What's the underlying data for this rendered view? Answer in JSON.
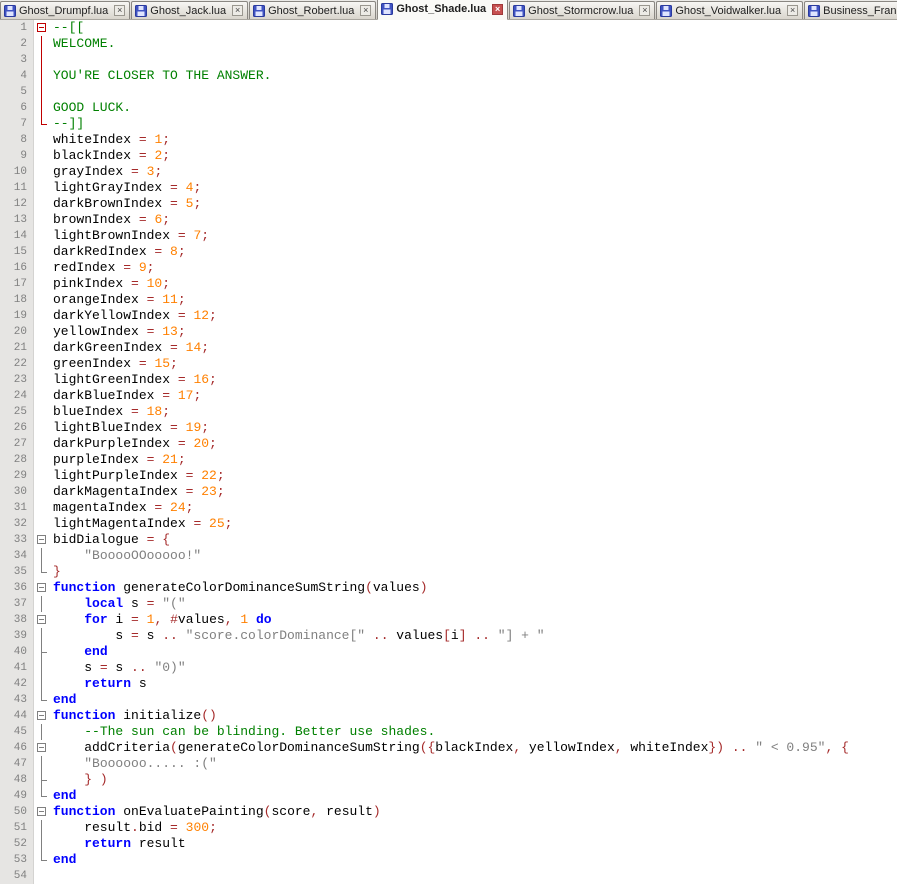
{
  "tab_bar": {
    "tab_icon": "floppy-disk-icon",
    "close_icon_name": "close-icon",
    "close_icon": "×",
    "tabs": [
      {
        "label": "Ghost_Drumpf.lua",
        "active": false
      },
      {
        "label": "Ghost_Jack.lua",
        "active": false
      },
      {
        "label": "Ghost_Robert.lua",
        "active": false
      },
      {
        "label": "Ghost_Shade.lua",
        "active": true
      },
      {
        "label": "Ghost_Stormcrow.lua",
        "active": false
      },
      {
        "label": "Ghost_Voidwalker.lua",
        "active": false
      },
      {
        "label": "Business_Frank.lua",
        "active": false
      }
    ]
  },
  "colors": {
    "comment": "#008000",
    "keyword": "#0000FF",
    "number": "#FF8000",
    "string": "#808080",
    "operator": "#A52A2A",
    "plain": "#000000",
    "line_number": "#808080",
    "margin_bg": "#E6E5E3",
    "fold": "#808080",
    "fold_active": "#C00000",
    "tab_close_active_bg": "#C75050"
  },
  "editor": {
    "lines": [
      {
        "n": 1,
        "fold": "open",
        "hot": true,
        "t": [
          [
            "c",
            "--[["
          ]
        ]
      },
      {
        "n": 2,
        "fold": "line",
        "hot": true,
        "t": [
          [
            "c",
            "WELCOME."
          ]
        ]
      },
      {
        "n": 3,
        "fold": "line",
        "hot": true,
        "t": []
      },
      {
        "n": 4,
        "fold": "line",
        "hot": true,
        "t": [
          [
            "c",
            "YOU'RE CLOSER TO THE ANSWER."
          ]
        ]
      },
      {
        "n": 5,
        "fold": "line",
        "hot": true,
        "t": []
      },
      {
        "n": 6,
        "fold": "line",
        "hot": true,
        "t": [
          [
            "c",
            "GOOD LUCK."
          ]
        ]
      },
      {
        "n": 7,
        "fold": "end",
        "hot": true,
        "t": [
          [
            "c",
            "--]]"
          ]
        ]
      },
      {
        "n": 8,
        "t": [
          [
            "p",
            "whiteIndex "
          ],
          [
            "o",
            "= "
          ],
          [
            "num",
            "1"
          ],
          [
            "o",
            ";"
          ]
        ]
      },
      {
        "n": 9,
        "t": [
          [
            "p",
            "blackIndex "
          ],
          [
            "o",
            "= "
          ],
          [
            "num",
            "2"
          ],
          [
            "o",
            ";"
          ]
        ]
      },
      {
        "n": 10,
        "t": [
          [
            "p",
            "grayIndex "
          ],
          [
            "o",
            "= "
          ],
          [
            "num",
            "3"
          ],
          [
            "o",
            ";"
          ]
        ]
      },
      {
        "n": 11,
        "t": [
          [
            "p",
            "lightGrayIndex "
          ],
          [
            "o",
            "= "
          ],
          [
            "num",
            "4"
          ],
          [
            "o",
            ";"
          ]
        ]
      },
      {
        "n": 12,
        "t": [
          [
            "p",
            "darkBrownIndex "
          ],
          [
            "o",
            "= "
          ],
          [
            "num",
            "5"
          ],
          [
            "o",
            ";"
          ]
        ]
      },
      {
        "n": 13,
        "t": [
          [
            "p",
            "brownIndex "
          ],
          [
            "o",
            "= "
          ],
          [
            "num",
            "6"
          ],
          [
            "o",
            ";"
          ]
        ]
      },
      {
        "n": 14,
        "t": [
          [
            "p",
            "lightBrownIndex "
          ],
          [
            "o",
            "= "
          ],
          [
            "num",
            "7"
          ],
          [
            "o",
            ";"
          ]
        ]
      },
      {
        "n": 15,
        "t": [
          [
            "p",
            "darkRedIndex "
          ],
          [
            "o",
            "= "
          ],
          [
            "num",
            "8"
          ],
          [
            "o",
            ";"
          ]
        ]
      },
      {
        "n": 16,
        "t": [
          [
            "p",
            "redIndex "
          ],
          [
            "o",
            "= "
          ],
          [
            "num",
            "9"
          ],
          [
            "o",
            ";"
          ]
        ]
      },
      {
        "n": 17,
        "t": [
          [
            "p",
            "pinkIndex "
          ],
          [
            "o",
            "= "
          ],
          [
            "num",
            "10"
          ],
          [
            "o",
            ";"
          ]
        ]
      },
      {
        "n": 18,
        "t": [
          [
            "p",
            "orangeIndex "
          ],
          [
            "o",
            "= "
          ],
          [
            "num",
            "11"
          ],
          [
            "o",
            ";"
          ]
        ]
      },
      {
        "n": 19,
        "t": [
          [
            "p",
            "darkYellowIndex "
          ],
          [
            "o",
            "= "
          ],
          [
            "num",
            "12"
          ],
          [
            "o",
            ";"
          ]
        ]
      },
      {
        "n": 20,
        "t": [
          [
            "p",
            "yellowIndex "
          ],
          [
            "o",
            "= "
          ],
          [
            "num",
            "13"
          ],
          [
            "o",
            ";"
          ]
        ]
      },
      {
        "n": 21,
        "t": [
          [
            "p",
            "darkGreenIndex "
          ],
          [
            "o",
            "= "
          ],
          [
            "num",
            "14"
          ],
          [
            "o",
            ";"
          ]
        ]
      },
      {
        "n": 22,
        "t": [
          [
            "p",
            "greenIndex "
          ],
          [
            "o",
            "= "
          ],
          [
            "num",
            "15"
          ],
          [
            "o",
            ";"
          ]
        ]
      },
      {
        "n": 23,
        "t": [
          [
            "p",
            "lightGreenIndex "
          ],
          [
            "o",
            "= "
          ],
          [
            "num",
            "16"
          ],
          [
            "o",
            ";"
          ]
        ]
      },
      {
        "n": 24,
        "t": [
          [
            "p",
            "darkBlueIndex "
          ],
          [
            "o",
            "= "
          ],
          [
            "num",
            "17"
          ],
          [
            "o",
            ";"
          ]
        ]
      },
      {
        "n": 25,
        "t": [
          [
            "p",
            "blueIndex "
          ],
          [
            "o",
            "= "
          ],
          [
            "num",
            "18"
          ],
          [
            "o",
            ";"
          ]
        ]
      },
      {
        "n": 26,
        "t": [
          [
            "p",
            "lightBlueIndex "
          ],
          [
            "o",
            "= "
          ],
          [
            "num",
            "19"
          ],
          [
            "o",
            ";"
          ]
        ]
      },
      {
        "n": 27,
        "t": [
          [
            "p",
            "darkPurpleIndex "
          ],
          [
            "o",
            "= "
          ],
          [
            "num",
            "20"
          ],
          [
            "o",
            ";"
          ]
        ]
      },
      {
        "n": 28,
        "t": [
          [
            "p",
            "purpleIndex "
          ],
          [
            "o",
            "= "
          ],
          [
            "num",
            "21"
          ],
          [
            "o",
            ";"
          ]
        ]
      },
      {
        "n": 29,
        "t": [
          [
            "p",
            "lightPurpleIndex "
          ],
          [
            "o",
            "= "
          ],
          [
            "num",
            "22"
          ],
          [
            "o",
            ";"
          ]
        ]
      },
      {
        "n": 30,
        "t": [
          [
            "p",
            "darkMagentaIndex "
          ],
          [
            "o",
            "= "
          ],
          [
            "num",
            "23"
          ],
          [
            "o",
            ";"
          ]
        ]
      },
      {
        "n": 31,
        "t": [
          [
            "p",
            "magentaIndex "
          ],
          [
            "o",
            "= "
          ],
          [
            "num",
            "24"
          ],
          [
            "o",
            ";"
          ]
        ]
      },
      {
        "n": 32,
        "t": [
          [
            "p",
            "lightMagentaIndex "
          ],
          [
            "o",
            "= "
          ],
          [
            "num",
            "25"
          ],
          [
            "o",
            ";"
          ]
        ]
      },
      {
        "n": 33,
        "fold": "open",
        "t": [
          [
            "p",
            "bidDialogue "
          ],
          [
            "o",
            "= {"
          ]
        ]
      },
      {
        "n": 34,
        "fold": "line",
        "t": [
          [
            "p",
            "    "
          ],
          [
            "s",
            "\"BooooOOooooo!\""
          ]
        ]
      },
      {
        "n": 35,
        "fold": "end",
        "t": [
          [
            "o",
            "}"
          ]
        ]
      },
      {
        "n": 36,
        "fold": "open",
        "t": [
          [
            "k",
            "function"
          ],
          [
            "p",
            " generateColorDominanceSumString"
          ],
          [
            "o",
            "("
          ],
          [
            "p",
            "values"
          ],
          [
            "o",
            ")"
          ]
        ]
      },
      {
        "n": 37,
        "fold": "line",
        "t": [
          [
            "p",
            "    "
          ],
          [
            "k",
            "local"
          ],
          [
            "p",
            " s "
          ],
          [
            "o",
            "= "
          ],
          [
            "s",
            "\"(\""
          ]
        ]
      },
      {
        "n": 38,
        "fold": "open",
        "t": [
          [
            "p",
            "    "
          ],
          [
            "k",
            "for"
          ],
          [
            "p",
            " i "
          ],
          [
            "o",
            "= "
          ],
          [
            "num",
            "1"
          ],
          [
            "o",
            ","
          ],
          [
            "p",
            " "
          ],
          [
            "o",
            "#"
          ],
          [
            "p",
            "values"
          ],
          [
            "o",
            ","
          ],
          [
            "p",
            " "
          ],
          [
            "num",
            "1"
          ],
          [
            "p",
            " "
          ],
          [
            "k",
            "do"
          ]
        ]
      },
      {
        "n": 39,
        "fold": "line",
        "t": [
          [
            "p",
            "        s "
          ],
          [
            "o",
            "= "
          ],
          [
            "p",
            "s "
          ],
          [
            "o",
            ".. "
          ],
          [
            "s",
            "\"score.colorDominance[\""
          ],
          [
            "p",
            " "
          ],
          [
            "o",
            ".. "
          ],
          [
            "p",
            "values"
          ],
          [
            "o",
            "["
          ],
          [
            "p",
            "i"
          ],
          [
            "o",
            "]"
          ],
          [
            "p",
            " "
          ],
          [
            "o",
            ".. "
          ],
          [
            "s",
            "\"] + \""
          ]
        ]
      },
      {
        "n": 40,
        "fold": "tee",
        "t": [
          [
            "p",
            "    "
          ],
          [
            "k",
            "end"
          ]
        ]
      },
      {
        "n": 41,
        "fold": "line",
        "t": [
          [
            "p",
            "    s "
          ],
          [
            "o",
            "= "
          ],
          [
            "p",
            "s "
          ],
          [
            "o",
            ".. "
          ],
          [
            "s",
            "\"0)\""
          ]
        ]
      },
      {
        "n": 42,
        "fold": "line",
        "t": [
          [
            "p",
            "    "
          ],
          [
            "k",
            "return"
          ],
          [
            "p",
            " s"
          ]
        ]
      },
      {
        "n": 43,
        "fold": "end",
        "t": [
          [
            "k",
            "end"
          ]
        ]
      },
      {
        "n": 44,
        "fold": "open",
        "t": [
          [
            "k",
            "function"
          ],
          [
            "p",
            " initialize"
          ],
          [
            "o",
            "()"
          ]
        ]
      },
      {
        "n": 45,
        "fold": "line",
        "t": [
          [
            "p",
            "    "
          ],
          [
            "c",
            "--The sun can be blinding. Better use shades."
          ]
        ]
      },
      {
        "n": 46,
        "fold": "open",
        "t": [
          [
            "p",
            "    addCriteria"
          ],
          [
            "o",
            "("
          ],
          [
            "p",
            "generateColorDominanceSumString"
          ],
          [
            "o",
            "({"
          ],
          [
            "p",
            "blackIndex"
          ],
          [
            "o",
            ","
          ],
          [
            "p",
            " yellowIndex"
          ],
          [
            "o",
            ","
          ],
          [
            "p",
            " whiteIndex"
          ],
          [
            "o",
            "})"
          ],
          [
            "p",
            " "
          ],
          [
            "o",
            ".. "
          ],
          [
            "s",
            "\" < 0.95\""
          ],
          [
            "o",
            ","
          ],
          [
            "p",
            " "
          ],
          [
            "o",
            "{"
          ]
        ]
      },
      {
        "n": 47,
        "fold": "line",
        "t": [
          [
            "p",
            "    "
          ],
          [
            "s",
            "\"Boooooo..... :(\""
          ]
        ]
      },
      {
        "n": 48,
        "fold": "tee",
        "t": [
          [
            "p",
            "    "
          ],
          [
            "o",
            "} )"
          ]
        ]
      },
      {
        "n": 49,
        "fold": "end",
        "t": [
          [
            "k",
            "end"
          ]
        ]
      },
      {
        "n": 50,
        "fold": "open",
        "t": [
          [
            "k",
            "function"
          ],
          [
            "p",
            " onEvaluatePainting"
          ],
          [
            "o",
            "("
          ],
          [
            "p",
            "score"
          ],
          [
            "o",
            ","
          ],
          [
            "p",
            " result"
          ],
          [
            "o",
            ")"
          ]
        ]
      },
      {
        "n": 51,
        "fold": "line",
        "t": [
          [
            "p",
            "    result"
          ],
          [
            "o",
            "."
          ],
          [
            "p",
            "bid "
          ],
          [
            "o",
            "= "
          ],
          [
            "num",
            "300"
          ],
          [
            "o",
            ";"
          ]
        ]
      },
      {
        "n": 52,
        "fold": "line",
        "t": [
          [
            "p",
            "    "
          ],
          [
            "k",
            "return"
          ],
          [
            "p",
            " result"
          ]
        ]
      },
      {
        "n": 53,
        "fold": "end",
        "t": [
          [
            "k",
            "end"
          ]
        ]
      },
      {
        "n": 54,
        "t": []
      }
    ]
  }
}
